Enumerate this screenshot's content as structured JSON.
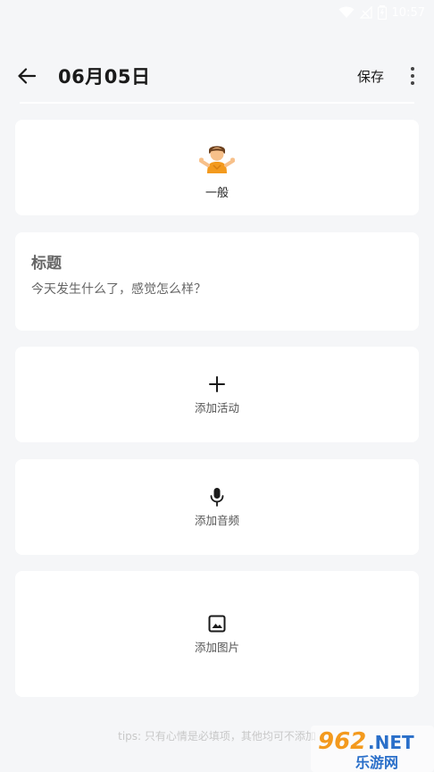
{
  "status_bar": {
    "time": "10:57",
    "icons": [
      "wifi-icon",
      "signal-icon",
      "battery-icon"
    ]
  },
  "header": {
    "back_icon": "arrow-left-icon",
    "title": "06月05日",
    "save_label": "保存",
    "more_icon": "more-vertical-icon"
  },
  "mood": {
    "emoji": "🤷",
    "label": "一般"
  },
  "entry": {
    "title_placeholder": "标题",
    "body_placeholder": "今天发生什么了，感觉怎么样？"
  },
  "actions": {
    "activity": {
      "icon": "plus-icon",
      "label": "添加活动"
    },
    "audio": {
      "icon": "microphone-icon",
      "label": "添加音频"
    },
    "image": {
      "icon": "image-icon",
      "label": "添加图片"
    }
  },
  "tips": "tips: 只有心情是必填项，其他均可不添加",
  "watermark": {
    "top_text": "962.NET",
    "bottom_text": "乐游网"
  },
  "colors": {
    "background": "#f5f6f8",
    "card": "#ffffff",
    "watermark_orange": "#f39a1e",
    "watermark_blue": "#2a6fc9"
  }
}
